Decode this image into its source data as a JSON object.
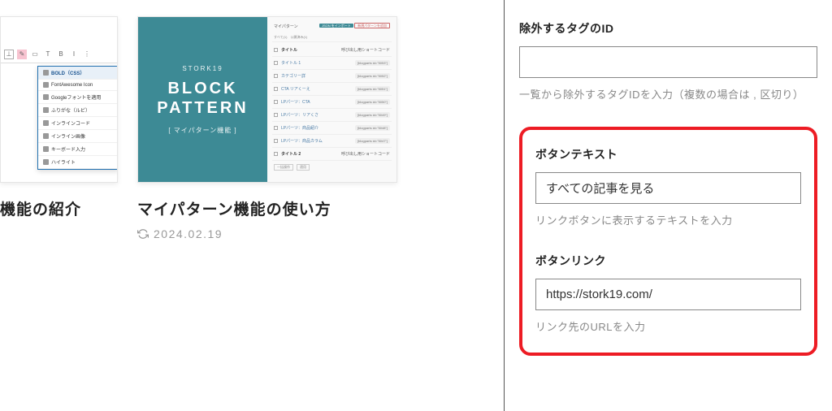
{
  "cards": [
    {
      "title": "機能の紹介",
      "dropdown": {
        "items": [
          {
            "label": "BOLD（CSS）"
          },
          {
            "label": "FontAwesome Icon"
          },
          {
            "label": "Googleフォントを適用"
          },
          {
            "label": "ふりがな（ルビ）"
          },
          {
            "label": "インラインコード"
          },
          {
            "label": "インライン画像"
          },
          {
            "label": "キーボード入力"
          },
          {
            "label": "ハイライト"
          }
        ]
      },
      "toolbar": {
        "t": "T",
        "b": "B",
        "i": "I"
      }
    },
    {
      "title": "マイパターン機能の使い方",
      "date": "2024.02.19",
      "thumb": {
        "brand": "STORK19",
        "main": "BLOCK PATTERN",
        "sub": "[ マイパターン機能 ]",
        "list_header": "マイパターン",
        "badge1": "JSON をインポート",
        "badge2": "新規パターンを追加",
        "subheader_items": [
          "すべて(1)",
          "公開済み(1)"
        ],
        "columns": [
          "タイトル",
          "呼び出し用ショートコード"
        ],
        "rows": [
          {
            "name": "タイトル 1",
            "code": "[blogparts id=\"5053\"]"
          },
          {
            "name": "カテゴリー詳",
            "code": "[blogparts id=\"5052\"]"
          },
          {
            "name": "CTA リアくーえ",
            "code": "[blogparts id=\"5051\"]"
          },
          {
            "name": "LPパーツ：CTA",
            "code": "[blogparts id=\"5050\"]"
          },
          {
            "name": "LPパーツ：リアくさ",
            "code": "[blogparts id=\"5049\"]"
          },
          {
            "name": "LPパーツ：商品紹介",
            "code": "[blogparts id=\"5048\"]"
          },
          {
            "name": "LPパーツ：商品カラム",
            "code": "[blogparts id=\"5047\"]"
          },
          {
            "name": "タイトル 2",
            "code": "呼び出し用ショートコード"
          }
        ],
        "footer_items": [
          "一括操作",
          "適用"
        ]
      }
    }
  ],
  "sidebar": {
    "exclude_tag": {
      "label": "除外するタグのID",
      "value": "",
      "help": "一覧から除外するタグIDを入力（複数の場合は , 区切り）"
    },
    "button_text": {
      "label": "ボタンテキスト",
      "value": "すべての記事を見る",
      "help": "リンクボタンに表示するテキストを入力"
    },
    "button_link": {
      "label": "ボタンリンク",
      "value": "https://stork19.com/",
      "help": "リンク先のURLを入力"
    }
  }
}
